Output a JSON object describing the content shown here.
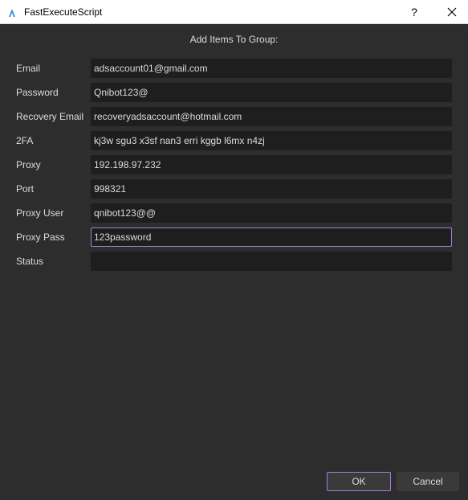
{
  "window": {
    "title": "FastExecuteScript",
    "help_label": "?"
  },
  "heading": "Add Items To Group:",
  "fields": [
    {
      "label": "Email",
      "value": "adsaccount01@gmail.com"
    },
    {
      "label": "Password",
      "value": "Qnibot123@"
    },
    {
      "label": "Recovery Email",
      "value": "recoveryadsaccount@hotmail.com"
    },
    {
      "label": "2FA",
      "value": "kj3w sgu3 x3sf nan3 erri kggb l6mx n4zj"
    },
    {
      "label": "Proxy",
      "value": "192.198.97.232"
    },
    {
      "label": "Port",
      "value": "998321"
    },
    {
      "label": "Proxy User",
      "value": "qnibot123@@"
    },
    {
      "label": "Proxy Pass",
      "value": "123password"
    },
    {
      "label": "Status",
      "value": ""
    }
  ],
  "buttons": {
    "ok": "OK",
    "cancel": "Cancel"
  },
  "colors": {
    "focus_accent": "#a77be0",
    "background": "#2d2d2d",
    "field_bg": "#1e1e1e",
    "app_icon": "#3d8fd9"
  }
}
